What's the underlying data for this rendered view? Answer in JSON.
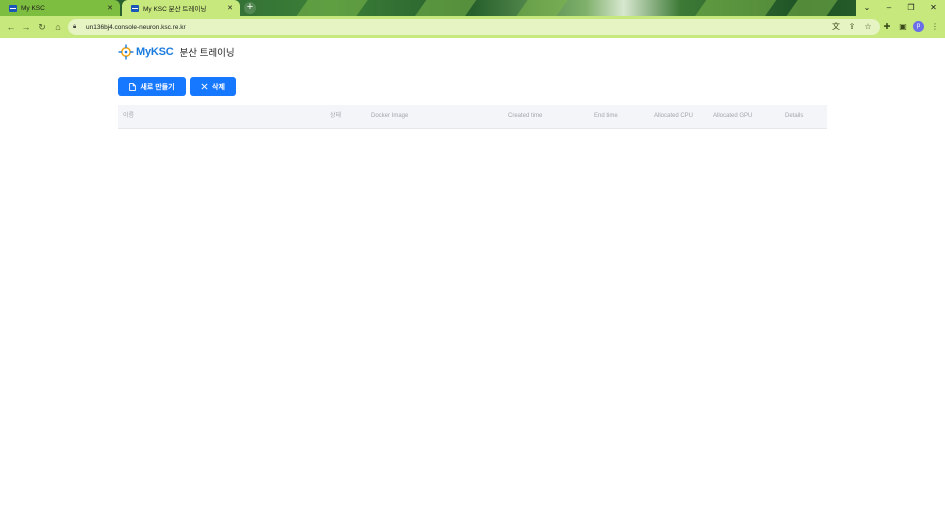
{
  "browser": {
    "tabs": [
      {
        "title": "My KSC",
        "active": false
      },
      {
        "title": "My KSC 분산 트레이닝",
        "active": true
      }
    ],
    "url": "un136bj4.console-neuron.ksc.re.kr",
    "profile_initial": "p",
    "accent_color": "#c6e87c"
  },
  "header": {
    "logo_text": "MyKSC",
    "page_title": "분산 트레이닝",
    "brand_color": "#1a7bdf"
  },
  "toolbar": {
    "create_label": "새로 만들기",
    "delete_label": "삭제",
    "button_color": "#1677ff"
  },
  "table": {
    "columns": [
      "이름",
      "상태",
      "Docker Image",
      "Created time",
      "End time",
      "Allocated CPU",
      "Allocated GPU",
      "Details"
    ],
    "rows": []
  }
}
